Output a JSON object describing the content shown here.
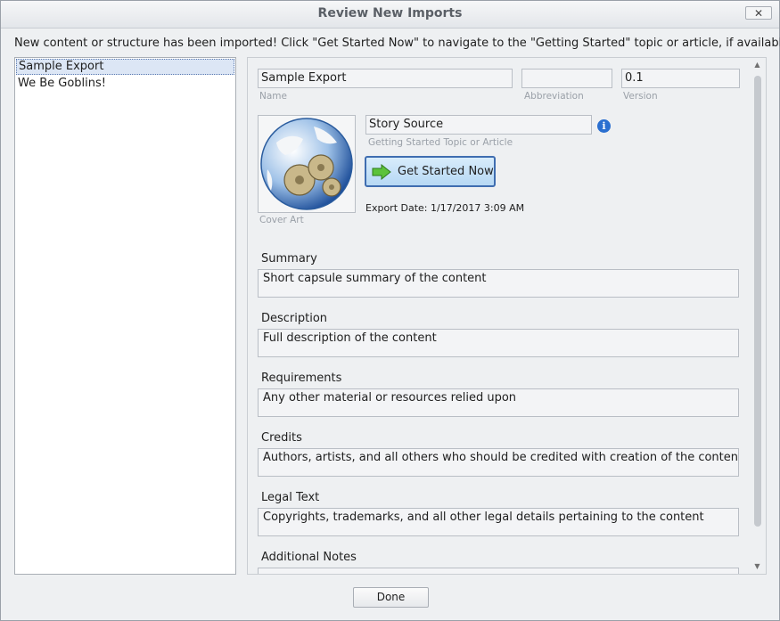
{
  "window": {
    "title": "Review New Imports",
    "close_label": "✕"
  },
  "intro": "New content or structure has been imported! Click \"Get Started Now\" to navigate to the \"Getting Started\" topic or article, if available.",
  "imports": [
    "Sample Export",
    "We Be Goblins!"
  ],
  "selected_import": "Sample Export",
  "details": {
    "name_value": "Sample Export",
    "name_caption": "Name",
    "abbreviation_value": "",
    "abbreviation_caption": "Abbreviation",
    "version_value": "0.1",
    "version_caption": "Version",
    "cover_art_caption": "Cover Art",
    "getting_started_value": "Story Source",
    "getting_started_caption": "Getting Started Topic or Article",
    "info_icon": "i",
    "get_started_label": "Get Started Now",
    "export_date": "Export Date: 1/17/2017 3:09 AM",
    "sections": {
      "summary_label": "Summary",
      "summary_value": "Short capsule summary of the content",
      "description_label": "Description",
      "description_value": "Full description of the content",
      "requirements_label": "Requirements",
      "requirements_value": "Any other material or resources relied upon",
      "credits_label": "Credits",
      "credits_value": "Authors, artists, and all others who should be credited with creation of the content",
      "legal_label": "Legal Text",
      "legal_value": "Copyrights, trademarks, and all other legal details pertaining to the content",
      "notes_label": "Additional Notes",
      "notes_value": ""
    }
  },
  "done_label": "Done",
  "icons": {
    "close": "close-icon",
    "info": "info-icon",
    "arrow": "green-arrow-icon",
    "cover": "globe-gears-icon"
  }
}
